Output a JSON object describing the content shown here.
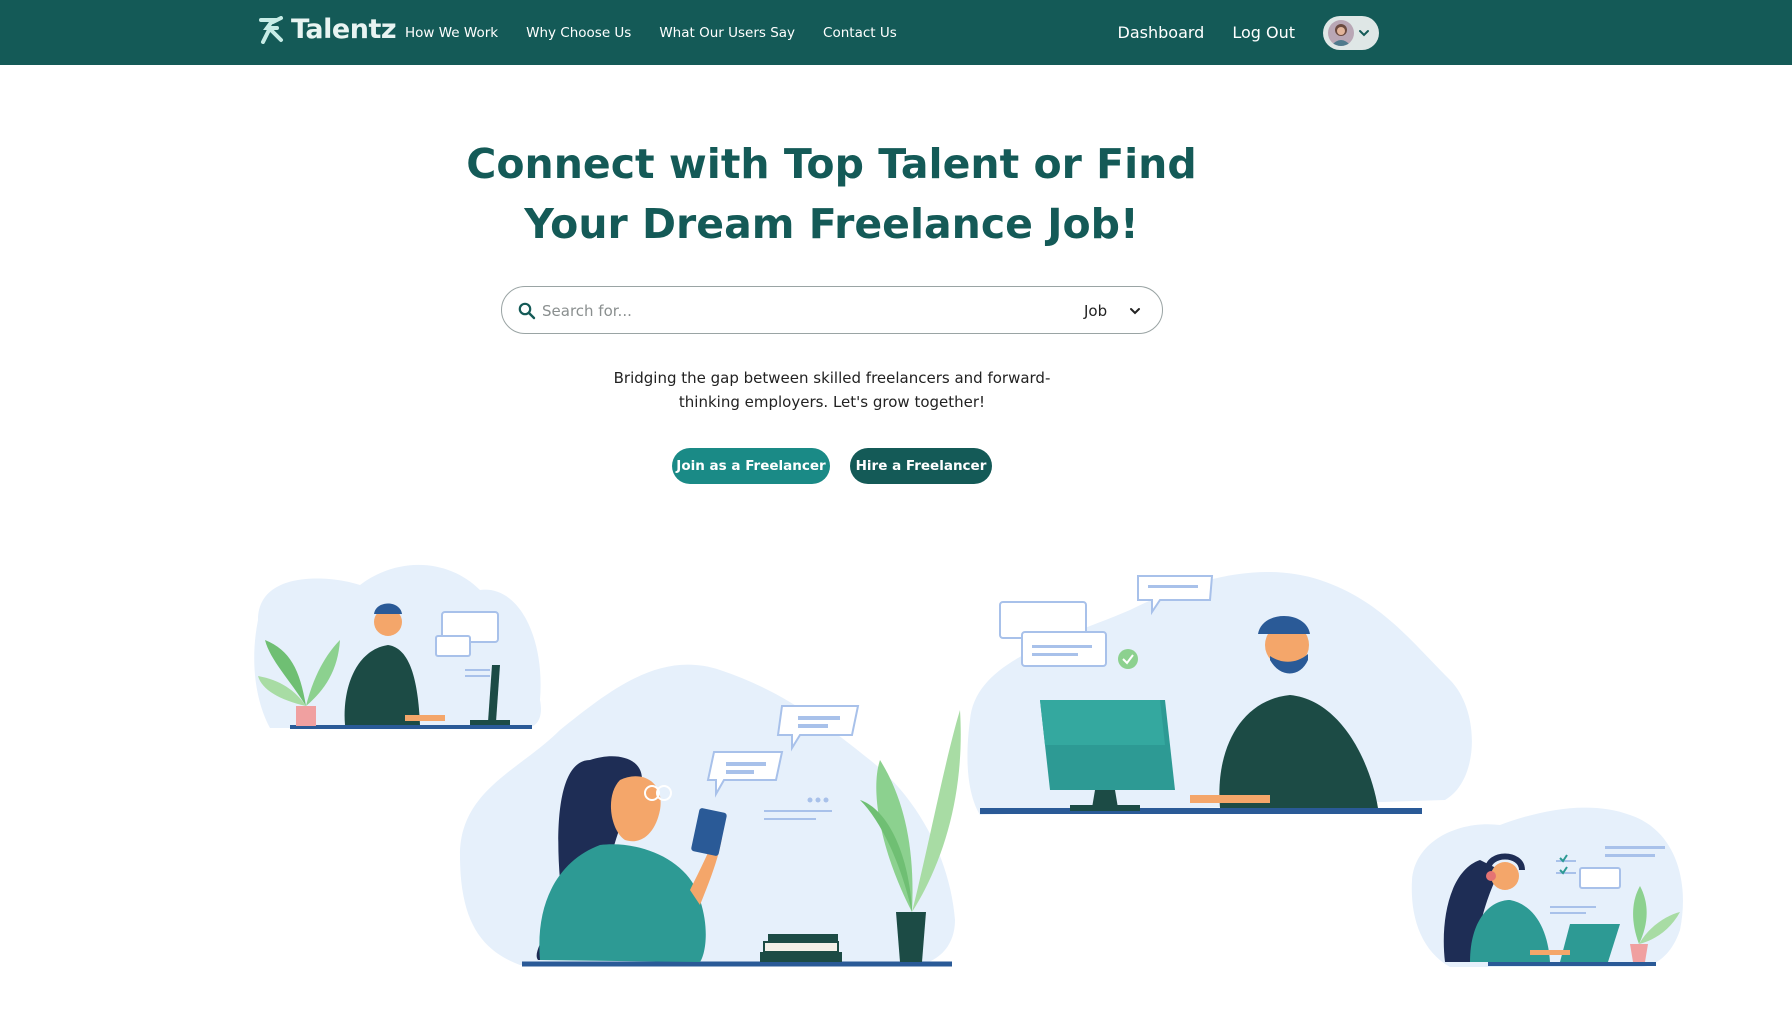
{
  "nav": {
    "logo_text": "Talentz",
    "links": [
      "How We Work",
      "Why Choose Us",
      "What Our Users Say",
      "Contact Us"
    ],
    "dashboard": "Dashboard",
    "logout": "Log Out"
  },
  "hero": {
    "title_line1": "Connect with Top Talent or Find",
    "title_line2": "Your Dream Freelance Job!",
    "search": {
      "placeholder": "Search for...",
      "type_selected": "Job"
    },
    "tagline_line1": "Bridging the gap between skilled freelancers and forward-",
    "tagline_line2": "thinking employers. Let's grow together!",
    "join_button": "Join as a Freelancer",
    "hire_button": "Hire a Freelancer"
  },
  "colors": {
    "nav_bg": "#145a57",
    "primary_dark": "#145a57",
    "primary_teal": "#1a8a86",
    "title": "#145a57",
    "blob": "#e6f0fb"
  },
  "icons": [
    "logo-icon",
    "search-icon",
    "chevron-down-icon",
    "avatar"
  ]
}
